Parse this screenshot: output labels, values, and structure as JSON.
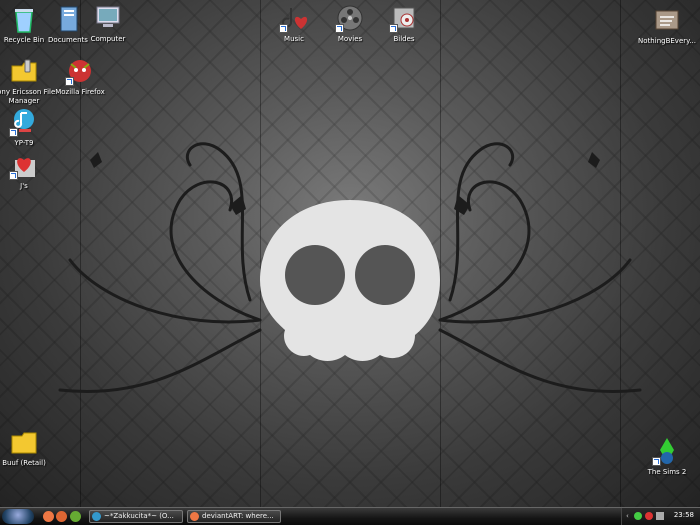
{
  "desktop_icons": [
    {
      "label": "Recycle Bin",
      "icon": "recycle-bin-icon"
    },
    {
      "label": "Documents",
      "icon": "documents-icon"
    },
    {
      "label": "Computer",
      "icon": "computer-icon"
    },
    {
      "label": "Sony Ericsson File Manager",
      "icon": "file-manager-icon"
    },
    {
      "label": "Mozilla Firefox",
      "icon": "firefox-icon"
    },
    {
      "label": "YP-T9",
      "icon": "music-player-icon"
    },
    {
      "label": "J's",
      "icon": "heart-icon"
    },
    {
      "label": "Music",
      "icon": "music-icon"
    },
    {
      "label": "Movies",
      "icon": "film-reel-icon"
    },
    {
      "label": "Bildes",
      "icon": "pictures-icon"
    },
    {
      "label": "NothingBEvery...",
      "icon": "folder-art-icon"
    },
    {
      "label": "Buuf (Retail)",
      "icon": "folder-icon"
    },
    {
      "label": "The Sims 2",
      "icon": "sims-icon"
    }
  ],
  "taskbar": {
    "tasks": [
      {
        "label": "~*Zakkucita*~ (O...",
        "icon": "messenger-icon"
      },
      {
        "label": "deviantART: where...",
        "icon": "firefox-icon"
      }
    ],
    "clock": "23:58"
  },
  "colors": {
    "skull": "#e4e4e4",
    "taskbar": "#151515"
  }
}
